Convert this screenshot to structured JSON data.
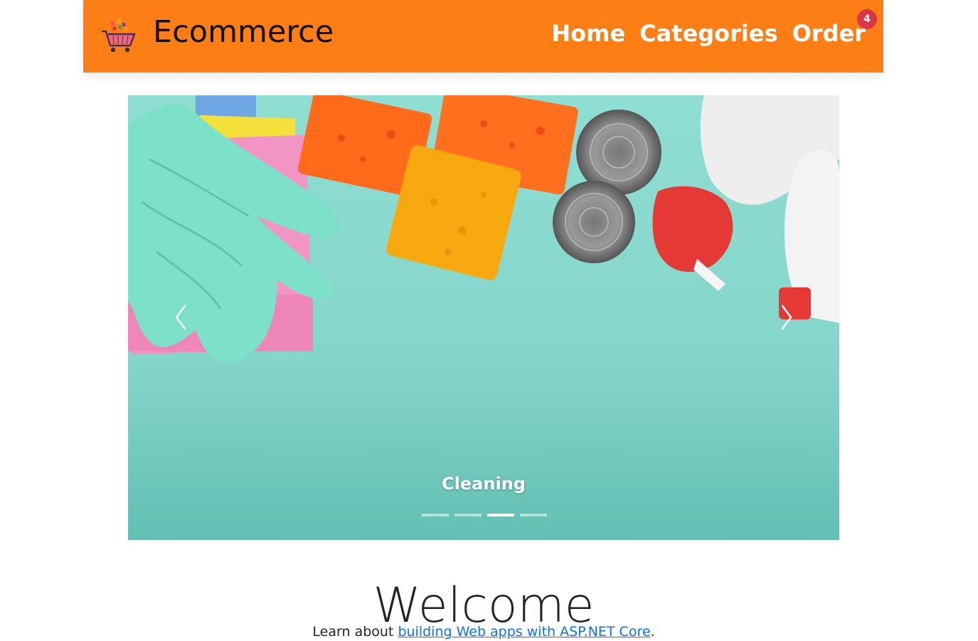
{
  "header": {
    "brand": "Ecommerce",
    "nav": [
      {
        "label": "Home"
      },
      {
        "label": "Categories"
      },
      {
        "label": "Order",
        "badge": "4"
      }
    ],
    "colors": {
      "navbar": "#fd7e14",
      "badge": "#dc3545"
    }
  },
  "carousel": {
    "caption": "Cleaning",
    "slide_count": 4,
    "active_index": 2,
    "prev_icon": "chevron-left-icon",
    "next_icon": "chevron-right-icon"
  },
  "main": {
    "heading": "Welcome",
    "learn_prefix": "Learn about ",
    "learn_link": "building Web apps with ASP.NET Core",
    "learn_suffix": "."
  }
}
